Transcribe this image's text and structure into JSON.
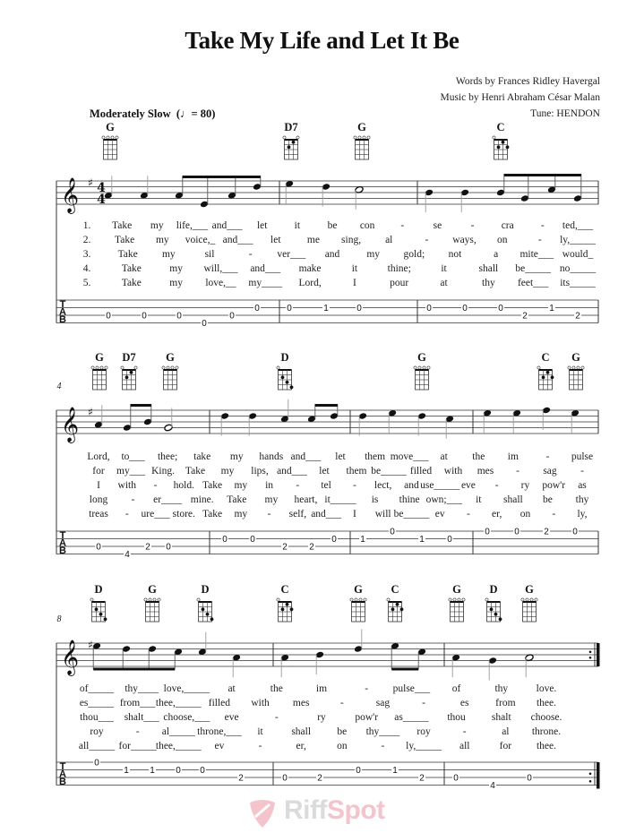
{
  "title": "Take My Life and Let It Be",
  "credits": {
    "words": "Words by Frances Ridley Havergal",
    "music": "Music by Henri Abraham César Malan",
    "tune": "Tune: HENDON"
  },
  "tempo": {
    "label": "Moderately Slow",
    "note_symbol": "♩",
    "bpm_text": "= 80"
  },
  "key_signature": "G major (1 sharp)",
  "time_signature": "4/4",
  "systems": [
    {
      "measure_number": "",
      "chords": [
        {
          "name": "G",
          "shape": "G"
        },
        {
          "name": "D7",
          "shape": "D7"
        },
        {
          "name": "G",
          "shape": "G"
        },
        {
          "name": "C",
          "shape": "C"
        }
      ],
      "measures": [
        {
          "tab": [
            [
              "A",
              "0"
            ],
            [
              "A",
              "0"
            ],
            [
              "A",
              "0"
            ],
            [
              "B",
              "0"
            ],
            [
              "A",
              "0"
            ],
            [
              "T",
              "0"
            ]
          ]
        },
        {
          "tab": [
            [
              "T",
              "0"
            ],
            [
              "T",
              "1"
            ],
            [
              "T",
              "0"
            ]
          ]
        },
        {
          "tab": [
            [
              "T",
              "0"
            ],
            [
              "T",
              "0"
            ],
            [
              "T",
              "0"
            ],
            [
              "B2",
              "2"
            ],
            [
              "T",
              "1"
            ],
            [
              "B2",
              "2"
            ]
          ]
        }
      ],
      "lyrics": [
        [
          "1.",
          "Take",
          "my",
          "life,___",
          "and___",
          "let",
          "it",
          "be",
          "con",
          "-",
          "se",
          "-",
          "cra",
          "-",
          "ted,___"
        ],
        [
          "2.",
          "Take",
          "my",
          "voice,_",
          "and___",
          "let",
          "me",
          "sing,",
          "al",
          "-",
          "ways,",
          "on",
          "-",
          "ly,_____"
        ],
        [
          "3.",
          "Take",
          "my",
          "sil",
          "-",
          "ver___",
          "and",
          "my",
          "gold;",
          "not",
          "a",
          "mite___",
          "would_"
        ],
        [
          "4.",
          "Take",
          "my",
          "will,___",
          "and___",
          "make",
          "it",
          "thine;",
          "it",
          "shall",
          "be_____",
          "no_____"
        ],
        [
          "5.",
          "Take",
          "my",
          "love,__",
          "my____",
          "Lord,",
          "I",
          "pour",
          "at",
          "thy",
          "feet___",
          "its_____"
        ]
      ]
    },
    {
      "measure_number": "4",
      "chords": [
        {
          "name": "G",
          "shape": "G"
        },
        {
          "name": "D7",
          "shape": "D7"
        },
        {
          "name": "G",
          "shape": "G"
        },
        {
          "name": "D",
          "shape": "D"
        },
        {
          "name": "G",
          "shape": "G"
        },
        {
          "name": "C",
          "shape": "C"
        },
        {
          "name": "G",
          "shape": "G"
        }
      ],
      "lyrics": [
        [
          "Lord,",
          "to___",
          "thee;",
          "take",
          "my",
          "hands",
          "and___",
          "let",
          "them",
          "move___",
          "at",
          "the",
          "im",
          "-",
          "pulse"
        ],
        [
          "for",
          "my___",
          "King.",
          "Take",
          "my",
          "lips,",
          "and___",
          "let",
          "them",
          "be_____",
          "filled",
          "with",
          "mes",
          "-",
          "sag",
          "-"
        ],
        [
          "I",
          "with",
          "-",
          "hold.",
          "Take",
          "my",
          "in",
          "-",
          "tel",
          "-",
          "lect,",
          "and",
          "use_____",
          "eve",
          "-",
          "ry",
          "pow'r",
          "as"
        ],
        [
          "long",
          "-",
          "er____",
          "mine.",
          "Take",
          "my",
          "heart,",
          "it_____",
          "is",
          "thine",
          "own;___",
          "it",
          "shall",
          "be",
          "thy"
        ],
        [
          "treas",
          "-",
          "ure___",
          "store.",
          "Take",
          "my",
          "-",
          "self,",
          "and___",
          "I",
          "will",
          "be_____",
          "ev",
          "-",
          "er,",
          "on",
          "-",
          "ly,"
        ]
      ]
    },
    {
      "measure_number": "8",
      "chords": [
        {
          "name": "D",
          "shape": "D"
        },
        {
          "name": "G",
          "shape": "G"
        },
        {
          "name": "D",
          "shape": "D"
        },
        {
          "name": "C",
          "shape": "C"
        },
        {
          "name": "G",
          "shape": "G"
        },
        {
          "name": "C",
          "shape": "C"
        },
        {
          "name": "G",
          "shape": "G"
        },
        {
          "name": "D",
          "shape": "D"
        },
        {
          "name": "G",
          "shape": "G"
        }
      ],
      "lyrics": [
        [
          "of_____",
          "thy____",
          "love,_____",
          "at",
          "the",
          "im",
          "-",
          "pulse___",
          "of",
          "thy",
          "love."
        ],
        [
          "es_____",
          "from___",
          "thee,_____",
          "filled",
          "with",
          "mes",
          "-",
          "sag",
          "-",
          "es",
          "from",
          "thee."
        ],
        [
          "thou___",
          "shalt___",
          "choose,___",
          "eve",
          "-",
          "ry",
          "pow'r",
          "as_____",
          "thou",
          "shalt",
          "choose."
        ],
        [
          "roy",
          "-",
          "al_____",
          "throne,___",
          "it",
          "shall",
          "be",
          "thy____",
          "roy",
          "-",
          "al",
          "throne."
        ],
        [
          "all_____",
          "for_____",
          "thee,_____",
          "ev",
          "-",
          "er,",
          "on",
          "-",
          "ly,_____",
          "all",
          "for",
          "thee."
        ]
      ]
    }
  ],
  "watermark": {
    "part1": "Riff",
    "part2": "Spot"
  },
  "colors": {
    "ink": "#111111",
    "staff": "#333333",
    "watermark_red": "#e05a6e",
    "watermark_gray": "#9a9a9a"
  }
}
